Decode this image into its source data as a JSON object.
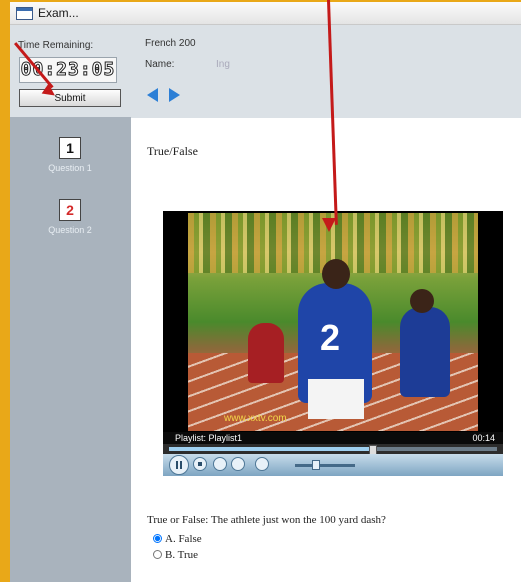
{
  "window": {
    "title": "Exam..."
  },
  "sidebar": {
    "time_label": "Time Remaining:",
    "timer": "00:23:05",
    "submit_label": "Submit",
    "questions": [
      {
        "number": "1",
        "label": "Question 1",
        "number_color": "#111111"
      },
      {
        "number": "2",
        "label": "Question 2",
        "number_color": "#d42a2a"
      }
    ]
  },
  "header": {
    "course": "French 200",
    "name_label": "Name:",
    "name_value": "Ing",
    "nav_icons": [
      "arrow-left-icon",
      "arrow-right-icon"
    ]
  },
  "main": {
    "question_type": "True/False",
    "media": {
      "watermark": "www.xxtv.com",
      "playlist": "Playlist: Playlist1",
      "time": "00:14",
      "seek_progress": 0.62,
      "volume_level": 0.35
    },
    "question": "True or False: The athlete just won the 100 yard dash?",
    "options": [
      {
        "label": "A. False",
        "selected": true
      },
      {
        "label": "B. True",
        "selected": false
      }
    ]
  },
  "colors": {
    "frame_background": "#e9a818",
    "annotation_arrow": "#c41a1a",
    "sidebar": "#a9b3bd",
    "nav_arrow": "#2c7fd6"
  }
}
